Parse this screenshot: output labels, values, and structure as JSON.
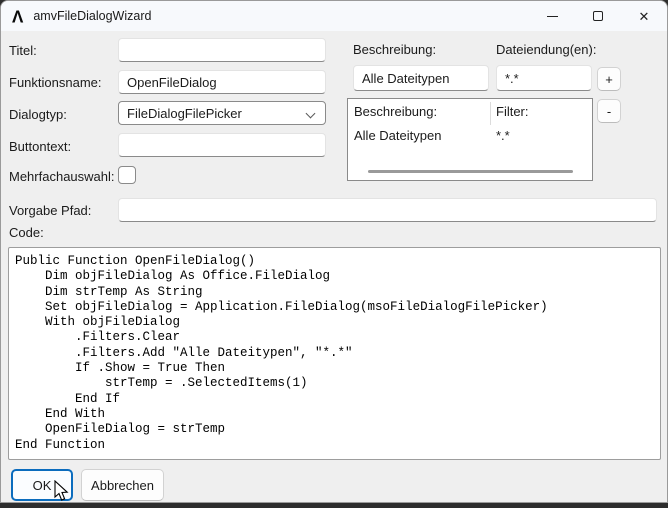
{
  "window": {
    "title": "amvFileDialogWizard",
    "icons": {
      "app_logo": "Λ",
      "close": "✕"
    }
  },
  "form": {
    "titel": {
      "label": "Titel:",
      "value": ""
    },
    "funktionsname": {
      "label": "Funktionsname:",
      "value": "OpenFileDialog"
    },
    "dialogtyp": {
      "label": "Dialogtyp:",
      "value": "FileDialogFilePicker"
    },
    "buttontext": {
      "label": "Buttontext:",
      "value": ""
    },
    "mehrfachauswahl": {
      "label": "Mehrfachauswahl:",
      "checked": false
    },
    "vorgabe_pfad": {
      "label": "Vorgabe Pfad:",
      "value": ""
    },
    "code_label": "Code:"
  },
  "filters": {
    "beschreibung_label": "Beschreibung:",
    "dateiendung_label": "Dateiendung(en):",
    "beschreibung_value": "Alle Dateitypen",
    "dateiendung_value": "*.*",
    "add_label": "+",
    "remove_label": "-",
    "list": {
      "columns": [
        "Beschreibung:",
        "Filter:"
      ],
      "rows": [
        {
          "beschreibung": "Alle Dateitypen",
          "filter": "*.*"
        }
      ]
    }
  },
  "code": "Public Function OpenFileDialog()\n    Dim objFileDialog As Office.FileDialog\n    Dim strTemp As String\n    Set objFileDialog = Application.FileDialog(msoFileDialogFilePicker)\n    With objFileDialog\n        .Filters.Clear\n        .Filters.Add \"Alle Dateitypen\", \"*.*\"\n        If .Show = True Then\n            strTemp = .SelectedItems(1)\n        End If\n    End With\n    OpenFileDialog = strTemp\nEnd Function",
  "buttons": {
    "ok": "OK",
    "cancel": "Abbrechen"
  },
  "colors": {
    "accent": "#0b6cbd",
    "titlebar": "#f7f9fc",
    "dialog_bg": "#efefef"
  }
}
